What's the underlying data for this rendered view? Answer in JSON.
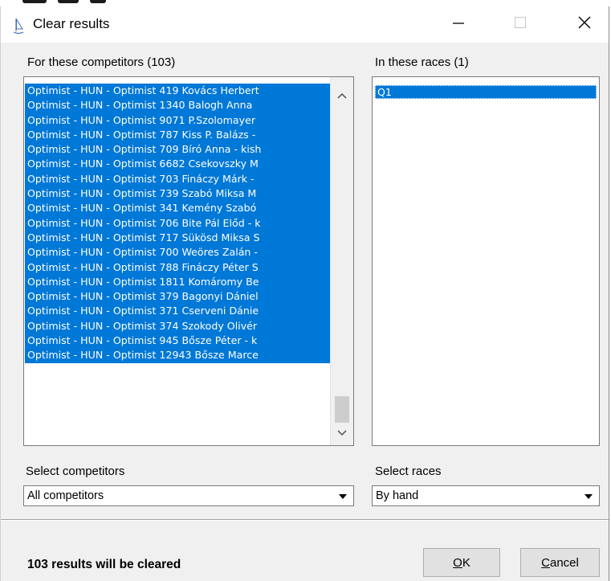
{
  "window": {
    "title": "Clear results"
  },
  "competitors": {
    "label": "For these competitors (103)",
    "items": [
      "Optimist - HUN - Optimist 419 Kovács Herbert",
      "Optimist - HUN - Optimist 1340 Balogh Anna",
      "Optimist - HUN - Optimist 9071 P.Szolomayer",
      "Optimist - HUN - Optimist 787 Kiss P. Balázs -",
      "Optimist - HUN - Optimist 709 Bíró Anna - kish",
      "Optimist - HUN - Optimist 6682 Csekovszky M",
      "Optimist - HUN - Optimist 703 Fináczy Márk -",
      "Optimist - HUN - Optimist 739 Szabó Miksa M",
      "Optimist - HUN - Optimist 341 Kemény  Szabó",
      "Optimist - HUN - Optimist 706 Bite Pál Előd - k",
      "Optimist - HUN - Optimist 717 Sükösd Miksa S",
      "Optimist - HUN - Optimist 700 Weöres Zalán -",
      "Optimist - HUN - Optimist 788 Fináczy Péter S",
      "Optimist - HUN - Optimist 1811 Komáromy  Be",
      "Optimist - HUN - Optimist 379 Bagonyi Dániel",
      "Optimist - HUN - Optimist 371 Cserveni Dánie",
      "Optimist - HUN - Optimist 374 Szokody Olivér",
      "Optimist - HUN - Optimist 945 Bősze Péter - k",
      "Optimist - HUN - Optimist 12943 Bősze Marce"
    ]
  },
  "races": {
    "label": "In these races (1)",
    "items": [
      "Q1"
    ]
  },
  "select_competitors": {
    "label": "Select competitors",
    "value": "All competitors"
  },
  "select_races": {
    "label": "Select races",
    "value": "By hand"
  },
  "footer": {
    "summary": "103 results will be cleared",
    "ok_mnemonic": "O",
    "ok_rest": "K",
    "cancel_mnemonic": "C",
    "cancel_rest": "ancel"
  },
  "colors": {
    "selection": "#0078d7",
    "window_bg": "#f0f0f0"
  },
  "icons": {
    "app": "sailboat-icon",
    "minimize": "minimize-icon",
    "maximize": "maximize-icon",
    "close": "close-icon"
  }
}
